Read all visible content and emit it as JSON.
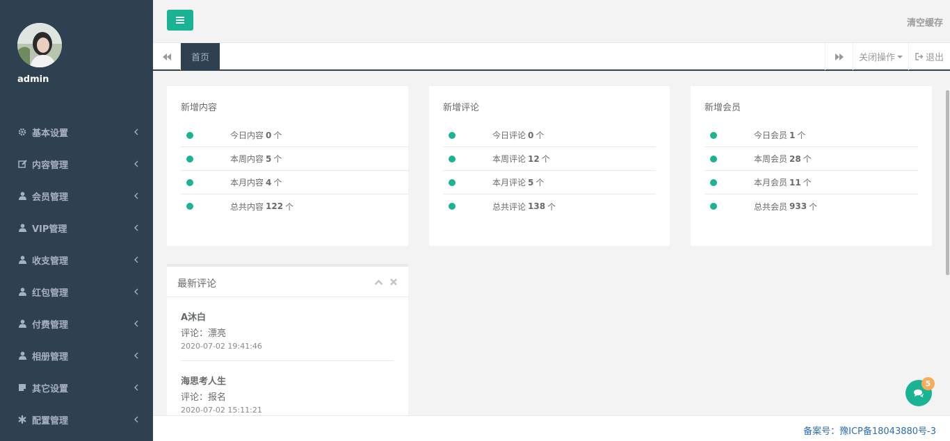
{
  "sidebar": {
    "username": "admin",
    "items": [
      {
        "label": "基本设置",
        "icon": "gear-icon"
      },
      {
        "label": "内容管理",
        "icon": "edit-icon"
      },
      {
        "label": "会员管理",
        "icon": "user-icon"
      },
      {
        "label": "VIP管理",
        "icon": "user-icon"
      },
      {
        "label": "收支管理",
        "icon": "user-icon"
      },
      {
        "label": "红包管理",
        "icon": "user-icon"
      },
      {
        "label": "付费管理",
        "icon": "user-icon"
      },
      {
        "label": "相册管理",
        "icon": "user-icon"
      },
      {
        "label": "其它设置",
        "icon": "note-icon"
      },
      {
        "label": "配置管理",
        "icon": "asterisk-icon"
      }
    ]
  },
  "header": {
    "clear_cache": "清空缓存"
  },
  "tabs": {
    "home": "首页",
    "close_ops": "关闭操作",
    "logout": "退出"
  },
  "cards": [
    {
      "title": "新增内容",
      "rows": [
        {
          "prefix": "今日内容",
          "value": "0",
          "unit": "个"
        },
        {
          "prefix": "本周内容",
          "value": "5",
          "unit": "个"
        },
        {
          "prefix": "本月内容",
          "value": "4",
          "unit": "个"
        },
        {
          "prefix": "总共内容",
          "value": "122",
          "unit": "个"
        }
      ]
    },
    {
      "title": "新增评论",
      "rows": [
        {
          "prefix": "今日评论",
          "value": "0",
          "unit": "个"
        },
        {
          "prefix": "本周评论",
          "value": "12",
          "unit": "个"
        },
        {
          "prefix": "本月评论",
          "value": "5",
          "unit": "个"
        },
        {
          "prefix": "总共评论",
          "value": "138",
          "unit": "个"
        }
      ]
    },
    {
      "title": "新增会员",
      "rows": [
        {
          "prefix": "今日会员",
          "value": "1",
          "unit": "个"
        },
        {
          "prefix": "本周会员",
          "value": "28",
          "unit": "个"
        },
        {
          "prefix": "本月会员",
          "value": "11",
          "unit": "个"
        },
        {
          "prefix": "总共会员",
          "value": "933",
          "unit": "个"
        }
      ]
    }
  ],
  "comments": {
    "title": "最新评论",
    "items": [
      {
        "user": "A沐白",
        "text": "评论：漂亮",
        "time": "2020-07-02 19:41:46"
      },
      {
        "user": "海思考人生",
        "text": "评论：报名",
        "time": "2020-07-02 15:11:21"
      }
    ]
  },
  "footer": {
    "icp": "备案号：豫ICP备18043880号-3"
  },
  "chat": {
    "badge": "5"
  },
  "colors": {
    "sidebar_bg": "#2f4050",
    "accent": "#1ab394",
    "badge": "#f8ac59",
    "link": "#2c6eaf"
  }
}
